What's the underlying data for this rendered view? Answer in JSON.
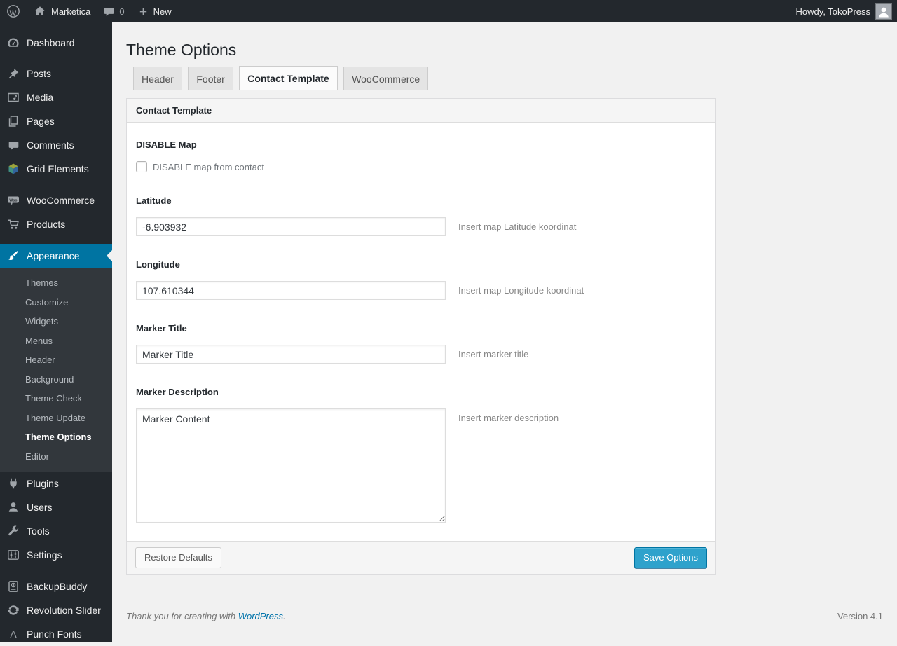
{
  "admin_bar": {
    "site_name": "Marketica",
    "comment_count": "0",
    "new_label": "New",
    "howdy": "Howdy, TokoPress"
  },
  "sidebar": {
    "items": [
      {
        "label": "Dashboard",
        "icon": "dashboard-icon"
      },
      {
        "label": "Posts",
        "icon": "pushpin-icon"
      },
      {
        "label": "Media",
        "icon": "media-icon"
      },
      {
        "label": "Pages",
        "icon": "pages-icon"
      },
      {
        "label": "Comments",
        "icon": "comment-bubble-icon"
      },
      {
        "label": "Grid Elements",
        "icon": "grid-elements-cube-icon"
      },
      {
        "label": "WooCommerce",
        "icon": "woocommerce-badge-icon"
      },
      {
        "label": "Products",
        "icon": "cart-icon"
      },
      {
        "label": "Appearance",
        "icon": "paintbrush-icon",
        "active": true
      },
      {
        "label": "Plugins",
        "icon": "plug-icon"
      },
      {
        "label": "Users",
        "icon": "user-icon"
      },
      {
        "label": "Tools",
        "icon": "wrench-icon"
      },
      {
        "label": "Settings",
        "icon": "sliders-icon"
      },
      {
        "label": "BackupBuddy",
        "icon": "backup-drive-icon"
      },
      {
        "label": "Revolution Slider",
        "icon": "refresh-arrows-icon"
      },
      {
        "label": "Punch Fonts",
        "icon": "letter-a-icon"
      }
    ],
    "appearance_submenu": [
      "Themes",
      "Customize",
      "Widgets",
      "Menus",
      "Header",
      "Background",
      "Theme Check",
      "Theme Update",
      "Theme Options",
      "Editor"
    ],
    "active_submenu": "Theme Options"
  },
  "page": {
    "title": "Theme Options",
    "tabs": [
      {
        "label": "Header",
        "active": false
      },
      {
        "label": "Footer",
        "active": false
      },
      {
        "label": "Contact Template",
        "active": true
      },
      {
        "label": "WooCommerce",
        "active": false
      }
    ],
    "panel": {
      "title": "Contact Template",
      "fields": {
        "disable_map": {
          "label": "DISABLE Map",
          "checkbox_label": "DISABLE map from contact",
          "checked": false
        },
        "latitude": {
          "label": "Latitude",
          "value": "-6.903932",
          "help": "Insert map Latitude koordinat"
        },
        "longitude": {
          "label": "Longitude",
          "value": "107.610344",
          "help": "Insert map Longitude koordinat"
        },
        "marker_title": {
          "label": "Marker Title",
          "value": "Marker Title",
          "help": "Insert marker title"
        },
        "marker_description": {
          "label": "Marker Description",
          "value": "Marker Content",
          "help": "Insert marker description"
        }
      },
      "restore_button": "Restore Defaults",
      "save_button": "Save Options"
    },
    "footer": {
      "thanks_prefix": "Thank you for creating with ",
      "wordpress_link": "WordPress",
      "thanks_suffix": ".",
      "version": "Version 4.1"
    }
  },
  "colors": {
    "admin_bar_bg": "#23282d",
    "sidebar_bg": "#23282d",
    "submenu_bg": "#32373c",
    "active_menu_bg": "#0074a2",
    "content_bg": "#f1f1f1",
    "primary_button_bg": "#2ea2cc",
    "primary_button_border": "#0074a2",
    "link": "#0073aa"
  }
}
